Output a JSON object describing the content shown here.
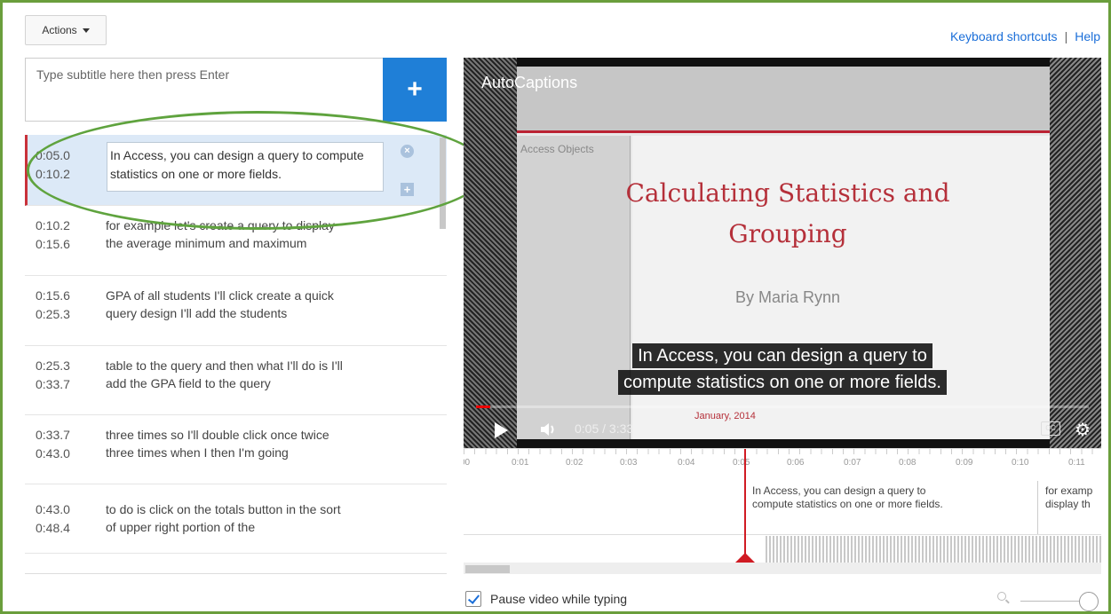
{
  "toolbar": {
    "actions_label": "Actions"
  },
  "links": {
    "shortcuts": "Keyboard shortcuts",
    "separator": "|",
    "help": "Help"
  },
  "subtitle_input": {
    "placeholder": "Type subtitle here then press Enter"
  },
  "add_button": {
    "label": "+"
  },
  "subtitles": [
    {
      "start": "0:05.0",
      "end": "0:10.2",
      "text": "In Access, you can design a query to compute statistics on one or more fields."
    },
    {
      "start": "0:10.2",
      "end": "0:15.6",
      "text": "for example let's create a query to display the average minimum and maximum"
    },
    {
      "start": "0:15.6",
      "end": "0:25.3",
      "text": "GPA of all students I'll click create a quick query design I'll add the students"
    },
    {
      "start": "0:25.3",
      "end": "0:33.7",
      "text": "table to the query and then what I'll do is I'll add the GPA field to the query"
    },
    {
      "start": "0:33.7",
      "end": "0:43.0",
      "text": "three times so I'll double click once twice three times when I then I'm going"
    },
    {
      "start": "0:43.0",
      "end": "0:48.4",
      "text": "to do is click on the totals button in the sort of upper right portion of the"
    }
  ],
  "video": {
    "title": "AutoCaptions",
    "panel_title": "Access Objects",
    "slide_title_line1": "Calculating Statistics and",
    "slide_title_line2": "Grouping",
    "slide_author": "By Maria Rynn",
    "slide_date": "January, 2014",
    "caption_line1": "In Access, you can design a query to",
    "caption_line2": "compute statistics on one or more fields.",
    "time": "0:05 / 3:33",
    "cc_label": "CC",
    "progress": 0.023
  },
  "timeline": {
    "ticks": [
      "00",
      "0:01",
      "0:02",
      "0:03",
      "0:04",
      "0:05",
      "0:06",
      "0:07",
      "0:08",
      "0:09",
      "0:10",
      "0:11"
    ],
    "segment1_line1": "In Access, you can design a query to",
    "segment1_line2": "compute statistics on one or more fields.",
    "segment2_line1": "for examp",
    "segment2_line2": "display th"
  },
  "options": {
    "pause_label": "Pause video while typing",
    "pause_checked": true
  },
  "colors": {
    "accent": "#1f7fd7",
    "playhead": "#d01b23",
    "frame": "#6a9e3c"
  }
}
